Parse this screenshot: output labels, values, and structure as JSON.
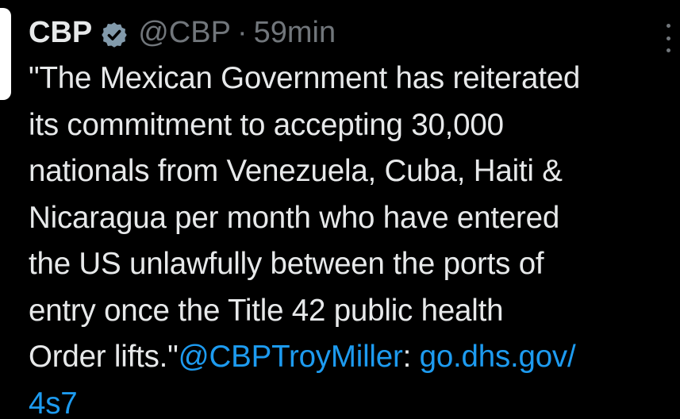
{
  "tweet": {
    "author_name": "CBP",
    "handle": "@CBP",
    "separator": "·",
    "timestamp": "59min",
    "icons": {
      "verified": "verified-badge-icon",
      "more": "more-options-icon"
    },
    "lines": [
      "\"The Mexican Government has reiterated",
      "its commitment to accepting 30,000",
      "nationals from Venezuela, Cuba, Haiti &",
      "Nicaragua per month who have entered",
      "the US unlawfully between the ports of",
      "entry once the Title 42 public health"
    ],
    "last_line_text": "Order lifts.\"",
    "mention": "@CBPTroyMiller",
    "mention_suffix": ":",
    "link_part1": "go.dhs.gov/",
    "link_part2": "4s7"
  },
  "colors": {
    "background": "#000000",
    "text": "#e7e9ea",
    "muted": "#71767b",
    "link": "#1d9bf0",
    "badge": "#829aab"
  }
}
